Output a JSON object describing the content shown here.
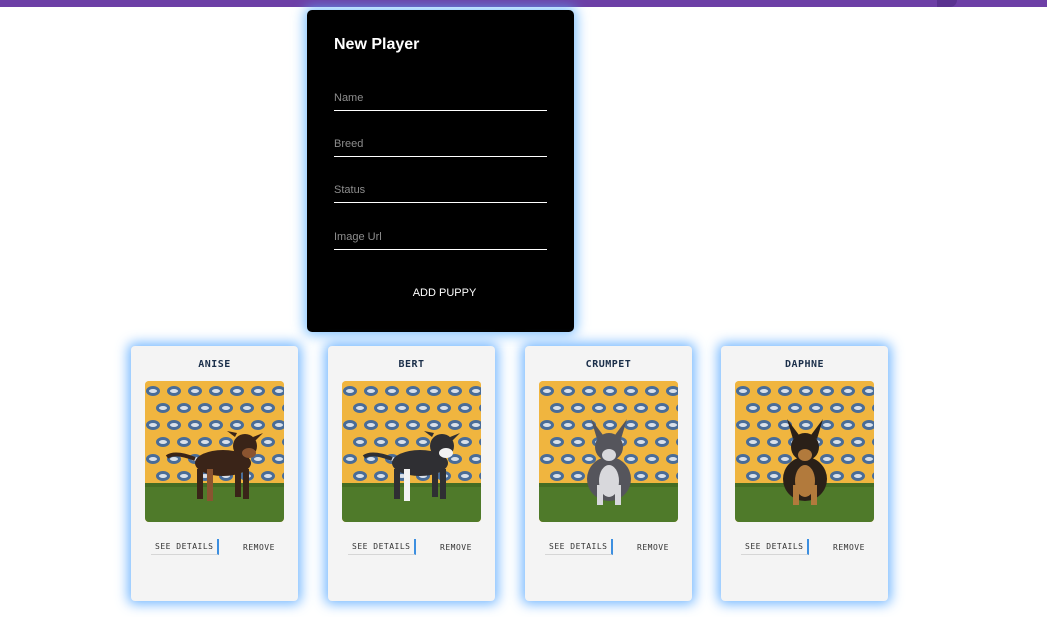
{
  "form": {
    "title": "New Player",
    "fields": {
      "name_placeholder": "Name",
      "breed_placeholder": "Breed",
      "status_placeholder": "Status",
      "image_placeholder": "Image Url"
    },
    "submit_label": "ADD PUPPY"
  },
  "colors": {
    "top_bar": "#6d3fa6",
    "card_glow": "#5aafff",
    "photo_backdrop": "#f0b53f",
    "grass": "#4f7a2a"
  },
  "puppies": [
    {
      "name": "ANISE",
      "details_label": "SEE DETAILS",
      "remove_label": "REMOVE",
      "coat": "#3a2418",
      "accent": "#8a5430",
      "pose": "standing"
    },
    {
      "name": "BERT",
      "details_label": "SEE DETAILS",
      "remove_label": "REMOVE",
      "coat": "#2f2f33",
      "accent": "#f2f2f2",
      "pose": "standing"
    },
    {
      "name": "CRUMPET",
      "details_label": "SEE DETAILS",
      "remove_label": "REMOVE",
      "coat": "#55555c",
      "accent": "#d8d8dc",
      "pose": "sitting"
    },
    {
      "name": "DAPHNE",
      "details_label": "SEE DETAILS",
      "remove_label": "REMOVE",
      "coat": "#2a2018",
      "accent": "#b27a3c",
      "pose": "sitting"
    }
  ]
}
